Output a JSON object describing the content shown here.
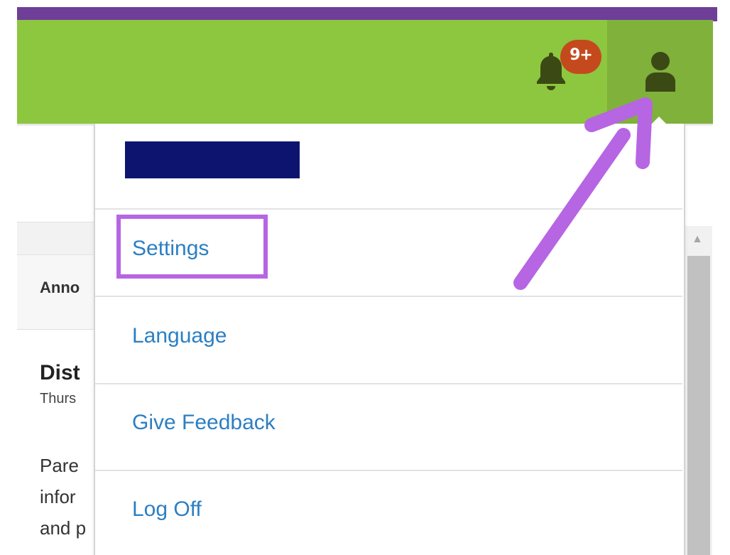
{
  "header": {
    "notification_badge": "9+",
    "colors": {
      "brand_green": "#8dc63f",
      "user_button_green": "#80b13b",
      "top_stripe_purple": "#6e3e99",
      "badge_red": "#c44a1e"
    }
  },
  "background": {
    "tab_label": "Anno",
    "post_title": "Dist",
    "post_date": "Thurs",
    "body_lines": [
      "Pare",
      "infor",
      "and p"
    ]
  },
  "user_menu": {
    "username_redacted": true,
    "items": [
      {
        "label": "Settings",
        "highlighted": true
      },
      {
        "label": "Language"
      },
      {
        "label": "Give Feedback"
      },
      {
        "label": "Log Off"
      }
    ],
    "link_color": "#2c7fc2"
  },
  "annotation": {
    "color": "#b665e3",
    "points_to": "user-icon"
  },
  "icons": {
    "bell": "bell-icon",
    "user": "user-icon",
    "scroll_up": "scroll-up-arrow-icon"
  }
}
